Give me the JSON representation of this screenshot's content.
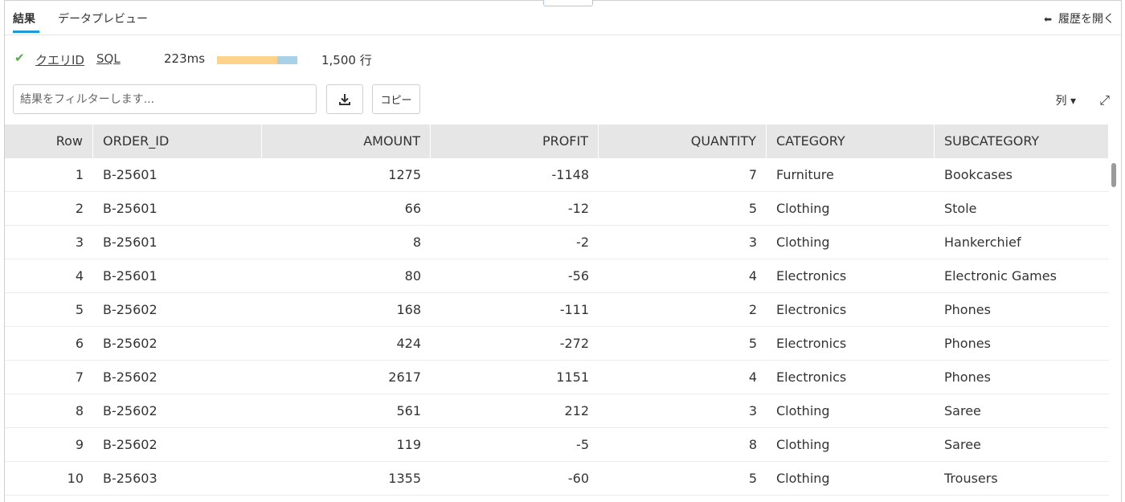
{
  "tabs": [
    {
      "label": "結果",
      "active": true
    },
    {
      "label": "データプレビュー",
      "active": false
    }
  ],
  "history_label": "履歴を開く",
  "status": {
    "query_id": "クエリID",
    "sql": "SQL",
    "duration": "223ms",
    "rows": "1,500 行",
    "progress_fraction": 0.75
  },
  "toolbar": {
    "filter_placeholder": "結果をフィルターします...",
    "copy_label": "コピー",
    "columns_label": "列 ▾"
  },
  "table": {
    "columns": [
      "Row",
      "ORDER_ID",
      "AMOUNT",
      "PROFIT",
      "QUANTITY",
      "CATEGORY",
      "SUBCATEGORY"
    ],
    "rows": [
      [
        "1",
        "B-25601",
        "1275",
        "-1148",
        "7",
        "Furniture",
        "Bookcases"
      ],
      [
        "2",
        "B-25601",
        "66",
        "-12",
        "5",
        "Clothing",
        "Stole"
      ],
      [
        "3",
        "B-25601",
        "8",
        "-2",
        "3",
        "Clothing",
        "Hankerchief"
      ],
      [
        "4",
        "B-25601",
        "80",
        "-56",
        "4",
        "Electronics",
        "Electronic Games"
      ],
      [
        "5",
        "B-25602",
        "168",
        "-111",
        "2",
        "Electronics",
        "Phones"
      ],
      [
        "6",
        "B-25602",
        "424",
        "-272",
        "5",
        "Electronics",
        "Phones"
      ],
      [
        "7",
        "B-25602",
        "2617",
        "1151",
        "4",
        "Electronics",
        "Phones"
      ],
      [
        "8",
        "B-25602",
        "561",
        "212",
        "3",
        "Clothing",
        "Saree"
      ],
      [
        "9",
        "B-25602",
        "119",
        "-5",
        "8",
        "Clothing",
        "Saree"
      ],
      [
        "10",
        "B-25603",
        "1355",
        "-60",
        "5",
        "Clothing",
        "Trousers"
      ]
    ]
  },
  "icons": {
    "success": "check-icon",
    "back": "arrow-left-icon",
    "download": "download-icon",
    "expand": "expand-icon"
  },
  "colors": {
    "accent": "#1a9ad6",
    "success": "#5aa84a",
    "bar_fill": "#fdd28b",
    "bar_rest": "#a8d0e6",
    "header_bg": "#e6e6e6"
  }
}
